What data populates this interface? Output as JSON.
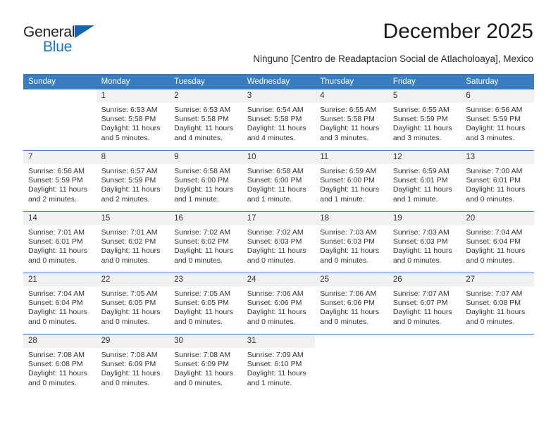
{
  "brand": {
    "name_dark": "General",
    "name_blue": "Blue",
    "accent_color": "#1476c4",
    "header_color": "#3a7cc0"
  },
  "header": {
    "month_title": "December 2025",
    "location": "Ninguno [Centro de Readaptacion Social de Atlacholoaya], Mexico"
  },
  "calendar": {
    "weekday_headers": [
      "Sunday",
      "Monday",
      "Tuesday",
      "Wednesday",
      "Thursday",
      "Friday",
      "Saturday"
    ],
    "weeks": [
      [
        {
          "day": "",
          "empty": true
        },
        {
          "day": "1",
          "sunrise": "Sunrise: 6:53 AM",
          "sunset": "Sunset: 5:58 PM",
          "daylight": "Daylight: 11 hours and 5 minutes."
        },
        {
          "day": "2",
          "sunrise": "Sunrise: 6:53 AM",
          "sunset": "Sunset: 5:58 PM",
          "daylight": "Daylight: 11 hours and 4 minutes."
        },
        {
          "day": "3",
          "sunrise": "Sunrise: 6:54 AM",
          "sunset": "Sunset: 5:58 PM",
          "daylight": "Daylight: 11 hours and 4 minutes."
        },
        {
          "day": "4",
          "sunrise": "Sunrise: 6:55 AM",
          "sunset": "Sunset: 5:58 PM",
          "daylight": "Daylight: 11 hours and 3 minutes."
        },
        {
          "day": "5",
          "sunrise": "Sunrise: 6:55 AM",
          "sunset": "Sunset: 5:59 PM",
          "daylight": "Daylight: 11 hours and 3 minutes."
        },
        {
          "day": "6",
          "sunrise": "Sunrise: 6:56 AM",
          "sunset": "Sunset: 5:59 PM",
          "daylight": "Daylight: 11 hours and 3 minutes."
        }
      ],
      [
        {
          "day": "7",
          "sunrise": "Sunrise: 6:56 AM",
          "sunset": "Sunset: 5:59 PM",
          "daylight": "Daylight: 11 hours and 2 minutes."
        },
        {
          "day": "8",
          "sunrise": "Sunrise: 6:57 AM",
          "sunset": "Sunset: 5:59 PM",
          "daylight": "Daylight: 11 hours and 2 minutes."
        },
        {
          "day": "9",
          "sunrise": "Sunrise: 6:58 AM",
          "sunset": "Sunset: 6:00 PM",
          "daylight": "Daylight: 11 hours and 1 minute."
        },
        {
          "day": "10",
          "sunrise": "Sunrise: 6:58 AM",
          "sunset": "Sunset: 6:00 PM",
          "daylight": "Daylight: 11 hours and 1 minute."
        },
        {
          "day": "11",
          "sunrise": "Sunrise: 6:59 AM",
          "sunset": "Sunset: 6:00 PM",
          "daylight": "Daylight: 11 hours and 1 minute."
        },
        {
          "day": "12",
          "sunrise": "Sunrise: 6:59 AM",
          "sunset": "Sunset: 6:01 PM",
          "daylight": "Daylight: 11 hours and 1 minute."
        },
        {
          "day": "13",
          "sunrise": "Sunrise: 7:00 AM",
          "sunset": "Sunset: 6:01 PM",
          "daylight": "Daylight: 11 hours and 0 minutes."
        }
      ],
      [
        {
          "day": "14",
          "sunrise": "Sunrise: 7:01 AM",
          "sunset": "Sunset: 6:01 PM",
          "daylight": "Daylight: 11 hours and 0 minutes."
        },
        {
          "day": "15",
          "sunrise": "Sunrise: 7:01 AM",
          "sunset": "Sunset: 6:02 PM",
          "daylight": "Daylight: 11 hours and 0 minutes."
        },
        {
          "day": "16",
          "sunrise": "Sunrise: 7:02 AM",
          "sunset": "Sunset: 6:02 PM",
          "daylight": "Daylight: 11 hours and 0 minutes."
        },
        {
          "day": "17",
          "sunrise": "Sunrise: 7:02 AM",
          "sunset": "Sunset: 6:03 PM",
          "daylight": "Daylight: 11 hours and 0 minutes."
        },
        {
          "day": "18",
          "sunrise": "Sunrise: 7:03 AM",
          "sunset": "Sunset: 6:03 PM",
          "daylight": "Daylight: 11 hours and 0 minutes."
        },
        {
          "day": "19",
          "sunrise": "Sunrise: 7:03 AM",
          "sunset": "Sunset: 6:03 PM",
          "daylight": "Daylight: 11 hours and 0 minutes."
        },
        {
          "day": "20",
          "sunrise": "Sunrise: 7:04 AM",
          "sunset": "Sunset: 6:04 PM",
          "daylight": "Daylight: 11 hours and 0 minutes."
        }
      ],
      [
        {
          "day": "21",
          "sunrise": "Sunrise: 7:04 AM",
          "sunset": "Sunset: 6:04 PM",
          "daylight": "Daylight: 11 hours and 0 minutes."
        },
        {
          "day": "22",
          "sunrise": "Sunrise: 7:05 AM",
          "sunset": "Sunset: 6:05 PM",
          "daylight": "Daylight: 11 hours and 0 minutes."
        },
        {
          "day": "23",
          "sunrise": "Sunrise: 7:05 AM",
          "sunset": "Sunset: 6:05 PM",
          "daylight": "Daylight: 11 hours and 0 minutes."
        },
        {
          "day": "24",
          "sunrise": "Sunrise: 7:06 AM",
          "sunset": "Sunset: 6:06 PM",
          "daylight": "Daylight: 11 hours and 0 minutes."
        },
        {
          "day": "25",
          "sunrise": "Sunrise: 7:06 AM",
          "sunset": "Sunset: 6:06 PM",
          "daylight": "Daylight: 11 hours and 0 minutes."
        },
        {
          "day": "26",
          "sunrise": "Sunrise: 7:07 AM",
          "sunset": "Sunset: 6:07 PM",
          "daylight": "Daylight: 11 hours and 0 minutes."
        },
        {
          "day": "27",
          "sunrise": "Sunrise: 7:07 AM",
          "sunset": "Sunset: 6:08 PM",
          "daylight": "Daylight: 11 hours and 0 minutes."
        }
      ],
      [
        {
          "day": "28",
          "sunrise": "Sunrise: 7:08 AM",
          "sunset": "Sunset: 6:08 PM",
          "daylight": "Daylight: 11 hours and 0 minutes."
        },
        {
          "day": "29",
          "sunrise": "Sunrise: 7:08 AM",
          "sunset": "Sunset: 6:09 PM",
          "daylight": "Daylight: 11 hours and 0 minutes."
        },
        {
          "day": "30",
          "sunrise": "Sunrise: 7:08 AM",
          "sunset": "Sunset: 6:09 PM",
          "daylight": "Daylight: 11 hours and 0 minutes."
        },
        {
          "day": "31",
          "sunrise": "Sunrise: 7:09 AM",
          "sunset": "Sunset: 6:10 PM",
          "daylight": "Daylight: 11 hours and 1 minute."
        },
        {
          "day": "",
          "empty": true
        },
        {
          "day": "",
          "empty": true
        },
        {
          "day": "",
          "empty": true
        }
      ]
    ]
  }
}
